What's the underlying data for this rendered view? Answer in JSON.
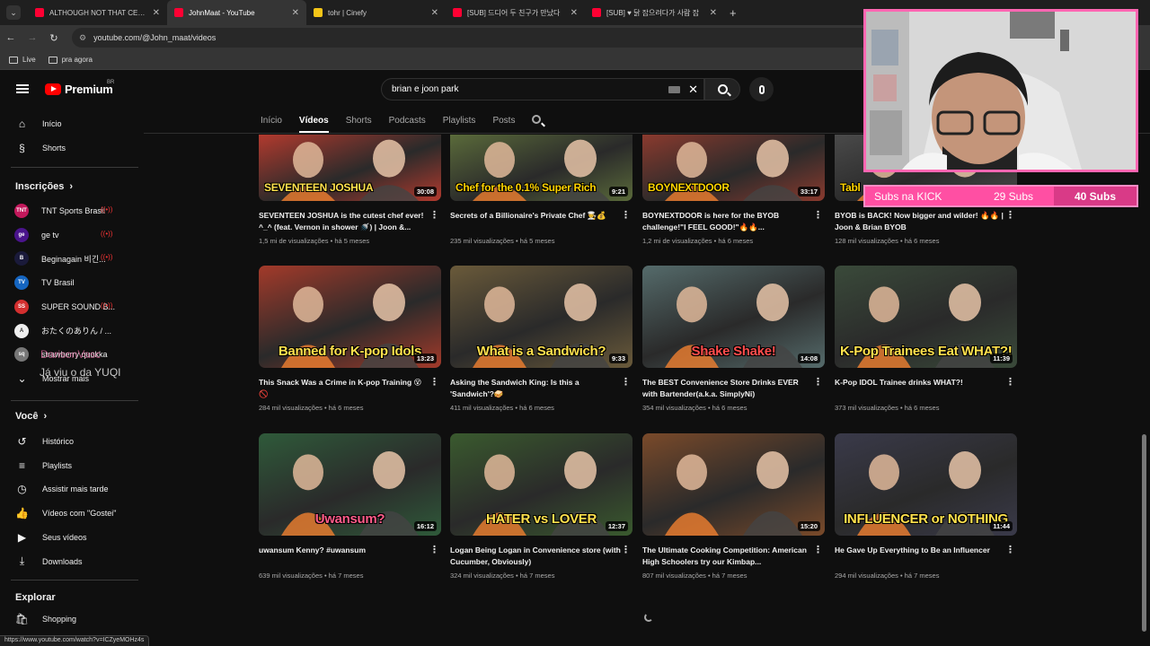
{
  "browser": {
    "tabs": [
      {
        "title": "ALTHOUGH NOT THAT CENTER",
        "color": "#ff0033",
        "active": false
      },
      {
        "title": "JohnMaat - YouTube",
        "color": "#ff0033",
        "active": true
      },
      {
        "title": "tohr | Cinefy",
        "color": "#f5c518",
        "active": false
      },
      {
        "title": "[SUB] 드디어 두 친구가 만났다",
        "color": "#ff0033",
        "active": false
      },
      {
        "title": "[SUB] ♥ 닭 잡으려다가 사람 잡",
        "color": "#ff0033",
        "active": false
      }
    ],
    "url": "youtube.com/@John_maat/videos",
    "bookmarks": [
      "Live",
      "pra agora"
    ],
    "status_url": "https://www.youtube.com/watch?v=ICZyeMOHz4s"
  },
  "header": {
    "logo": "Premium",
    "region": "BR",
    "search_value": "brian e joon park"
  },
  "sidebar": {
    "main": [
      {
        "label": "Início",
        "icon": "home-icon",
        "glyph": "⌂"
      },
      {
        "label": "Shorts",
        "icon": "shorts-icon",
        "glyph": "§"
      }
    ],
    "subs_title": "Inscrições",
    "subs": [
      {
        "label": "TNT Sports Brasil",
        "color": "#c2185b",
        "abbr": "TNT",
        "live": true
      },
      {
        "label": "ge tv",
        "color": "#4a148c",
        "abbr": "ge",
        "live": true
      },
      {
        "label": "Beginagain 비긴...",
        "color": "#1a1a3a",
        "abbr": "B",
        "live": true
      },
      {
        "label": "TV Brasil",
        "color": "#1565c0",
        "abbr": "TV",
        "live": false
      },
      {
        "label": "SUPER SOUND B...",
        "color": "#d32f2f",
        "abbr": "SS",
        "live": true
      },
      {
        "label": "おたくのありん / ...",
        "color": "#eeeeee",
        "abbr": "A",
        "live": false
      },
      {
        "label": "strawberry quokka",
        "color": "#777777",
        "abbr": "sq",
        "live": false
      }
    ],
    "show_more": "Mostrar mais",
    "you_title": "Você",
    "you": [
      {
        "label": "Histórico",
        "icon": "history-icon",
        "glyph": "↺"
      },
      {
        "label": "Playlists",
        "icon": "playlists-icon",
        "glyph": "≡"
      },
      {
        "label": "Assistir mais tarde",
        "icon": "watch-later-icon",
        "glyph": "◷"
      },
      {
        "label": "Vídeos com \"Gostei\"",
        "icon": "like-icon",
        "glyph": "👍"
      },
      {
        "label": "Seus vídeos",
        "icon": "your-videos-icon",
        "glyph": "▶"
      },
      {
        "label": "Downloads",
        "icon": "download-icon",
        "glyph": "⤓"
      }
    ],
    "explore_title": "Explorar",
    "explore": [
      {
        "label": "Shopping",
        "icon": "shopping-icon",
        "glyph": "🛍"
      }
    ]
  },
  "chat_overlay": {
    "name": "DarisonVasc",
    "message": "Já viu o da YUQI"
  },
  "channel_tabs": [
    "Início",
    "Vídeos",
    "Shorts",
    "Podcasts",
    "Playlists",
    "Posts"
  ],
  "active_tab": "Vídeos",
  "videos": [
    {
      "title": "SEVENTEEN JOSHUA is the cutest chef ever! ^_^ (feat. Vernon in shower 🚿) | Joon &...",
      "views": "1,5 mi de visualizações",
      "age": "há 5 meses",
      "duration": "30:08",
      "banner": "SEVENTEEN JOSHUA",
      "banner_color": "#ffe14d",
      "bg": "#b23a2e"
    },
    {
      "title": "Secrets of a Billionaire's Private Chef 👨‍🍳💰",
      "views": "235 mil visualizações",
      "age": "há 5 meses",
      "duration": "9:21",
      "banner": "Chef for the 0.1% Super Rich",
      "banner_color": "#ffd400",
      "bg": "#5a6a3a"
    },
    {
      "title": "BOYNEXTDOOR is here for the BYOB challenge!\"I FEEL GOOD!\"🔥🔥...",
      "views": "1,2 mi de visualizações",
      "age": "há 6 meses",
      "duration": "33:17",
      "banner": "BOYNEXTDOOR",
      "banner_color": "#ffd400",
      "bg": "#8a3a2e"
    },
    {
      "title": "BYOB is BACK! Now bigger and wilder! 🔥🔥 | Joon & Brian BYOB",
      "views": "128 mil visualizações",
      "age": "há 6 meses",
      "duration": "",
      "banner": "Tabl",
      "banner_color": "#ffd400",
      "bg": "#4a4a4a"
    },
    {
      "title": "This Snack Was a Crime in K-pop Training 😵🚫",
      "views": "284 mil visualizações",
      "age": "há 6 meses",
      "duration": "13:23",
      "banner": "Banned for K-pop Idols",
      "banner_color": "#ffe14d",
      "bg": "#a33a2a"
    },
    {
      "title": "Asking the Sandwich King: Is this a 'Sandwich'?🥪",
      "views": "411 mil visualizações",
      "age": "há 6 meses",
      "duration": "9:33",
      "banner": "What is a Sandwich?",
      "banner_color": "#ffe14d",
      "bg": "#6a5a3a"
    },
    {
      "title": "The BEST Convenience Store Drinks EVER with Bartender(a.k.a. SimplyNi)",
      "views": "354 mil visualizações",
      "age": "há 6 meses",
      "duration": "14:08",
      "banner": "Shake Shake!",
      "banner_color": "#ff4d4d",
      "bg": "#556b6b"
    },
    {
      "title": "K-Pop IDOL Trainee drinks WHAT?!",
      "views": "373 mil visualizações",
      "age": "há 6 meses",
      "duration": "11:39",
      "banner": "K-Pop Trainees Eat WHAT?!",
      "banner_color": "#ffe14d",
      "bg": "#3a4a3a"
    },
    {
      "title": "uwansum Kenny? #uwansum",
      "views": "639 mil visualizações",
      "age": "há 7 meses",
      "duration": "16:12",
      "banner": "Uwansum?",
      "banner_color": "#ff5c8a",
      "bg": "#2f5a3a"
    },
    {
      "title": "Logan Being Logan in Convenience store (with Cucumber, Obviously)",
      "views": "324 mil visualizações",
      "age": "há 7 meses",
      "duration": "12:37",
      "banner": "HATER vs LOVER",
      "banner_color": "#ffe14d",
      "bg": "#3a5a2e"
    },
    {
      "title": "The Ultimate Cooking Competition: American High Schoolers try our Kimbap...",
      "views": "807 mil visualizações",
      "age": "há 7 meses",
      "duration": "15:20",
      "banner": "",
      "banner_color": "#ffffff",
      "bg": "#7a4a2a"
    },
    {
      "title": "He Gave Up Everything to Be an Influencer",
      "views": "294 mil visualizações",
      "age": "há 7 meses",
      "duration": "11:44",
      "banner": "INFLUENCER or NOTHING",
      "banner_color": "#ffe14d",
      "bg": "#3a3a4a"
    }
  ],
  "stream_overlay": {
    "label1": "Subs na KICK",
    "label2": "29 Subs",
    "label3": "40 Subs"
  }
}
